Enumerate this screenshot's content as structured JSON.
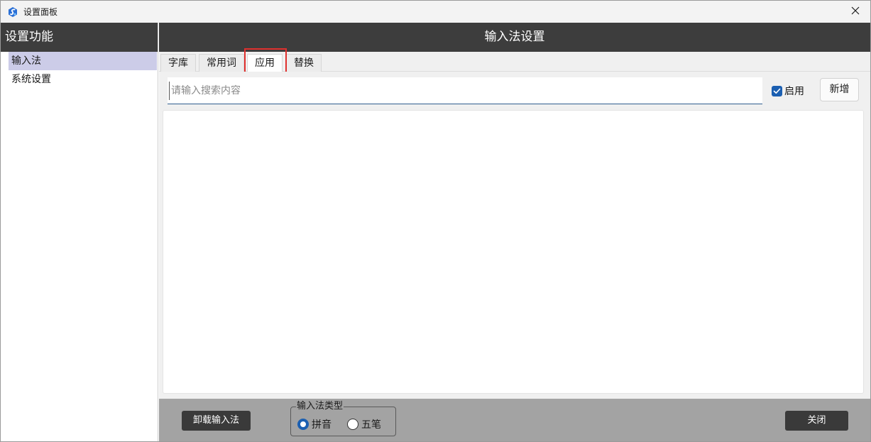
{
  "window": {
    "title": "设置面板",
    "app_icon": "app-logo-icon",
    "close_icon": "close-icon"
  },
  "sidebar": {
    "header": "设置功能",
    "items": [
      {
        "label": "输入法",
        "selected": true
      },
      {
        "label": "系统设置",
        "selected": false
      }
    ]
  },
  "main": {
    "header": "输入法设置",
    "tabs": [
      {
        "label": "字库",
        "active": false
      },
      {
        "label": "常用词",
        "active": false
      },
      {
        "label": "应用",
        "active": true
      },
      {
        "label": "替换",
        "active": false
      }
    ],
    "search": {
      "placeholder": "请输入搜索内容",
      "value": ""
    },
    "enable_checkbox": {
      "label": "启用",
      "checked": true
    },
    "add_button": "新增"
  },
  "footer": {
    "uninstall_button": "卸载输入法",
    "ime_type_group": {
      "legend": "输入法类型",
      "options": [
        {
          "label": "拼音",
          "checked": true
        },
        {
          "label": "五笔",
          "checked": false
        }
      ]
    },
    "close_button": "关闭"
  },
  "colors": {
    "header_bg": "#3d3d3d",
    "sidebar_selected": "#cccce8",
    "accent": "#1b5fb1",
    "footer_bg": "#a3a3a3",
    "highlight_box": "#e0302e"
  }
}
